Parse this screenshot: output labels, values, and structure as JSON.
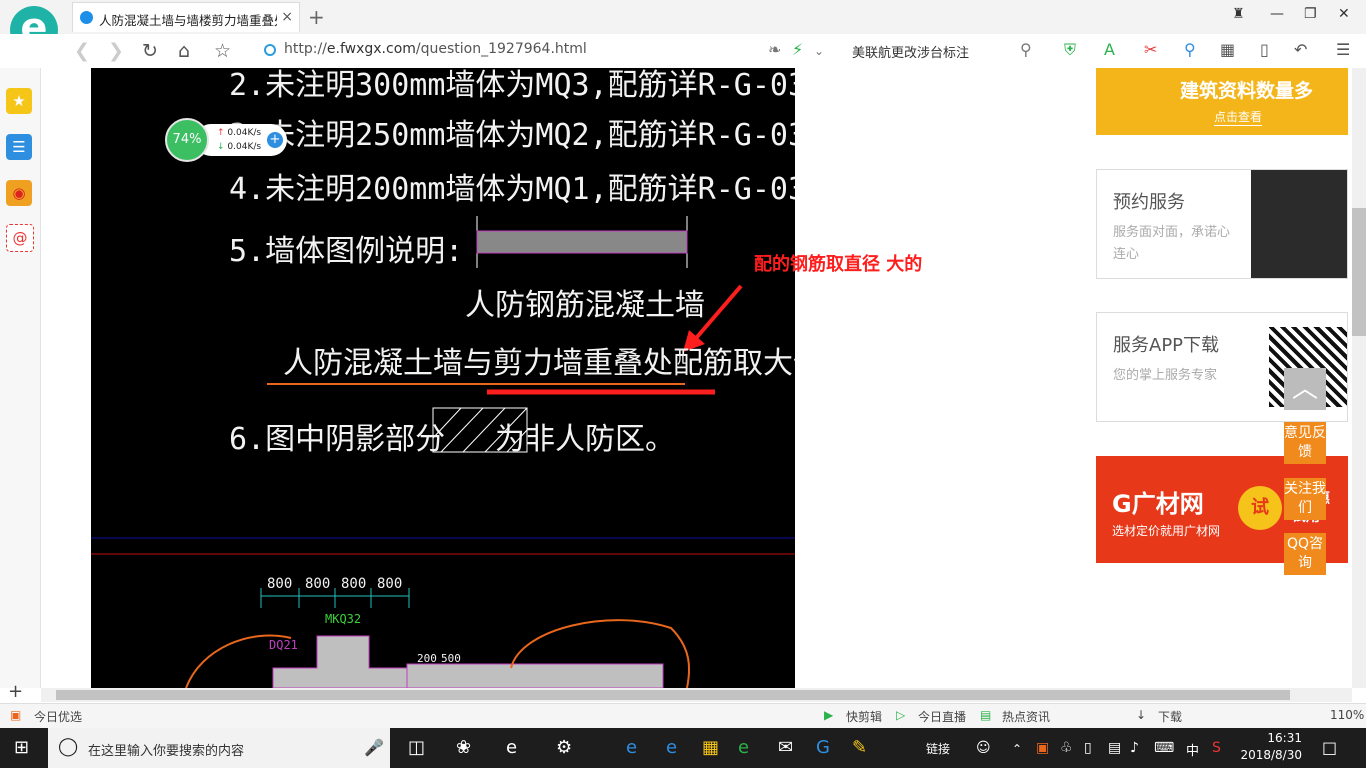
{
  "browser": {
    "tab_title": "人防混凝土墙与墙楼剪力墙重叠处",
    "tab_close": "×",
    "new_tab": "+",
    "url_prefix": "http://",
    "url_domain": "e.fwxgx.com",
    "url_path": "/question_1927964.html",
    "search_hint": "美联航更改涉台标注",
    "logo_letter": "e"
  },
  "speed_widget": {
    "percent": "74%",
    "up": "0.04K/s",
    "down": "0.04K/s"
  },
  "cad": {
    "line2": "2.未注明300mm墙体为MQ3,配筋详R-G-03。",
    "line3": "3.未注明250mm墙体为MQ2,配筋详R-G-03。",
    "line4": "4.未注明200mm墙体为MQ1,配筋详R-G-03。",
    "line5": "5.墙体图例说明:",
    "wall_label": "人防钢筋混凝土墙",
    "overlap_note": "人防混凝土墙与剪力墙重叠处配筋取大值。",
    "line6": "6.图中阴影部分",
    "line6_tail": "为非人防区。",
    "dims": [
      "800",
      "800",
      "800",
      "800"
    ],
    "tag_mkq": "MKQ32",
    "tag_dq": "DQ21",
    "dim_200": "200",
    "dim_500": "500"
  },
  "annotation": {
    "text": "配的钢筋取直径 大的",
    "color": "#ff1e1e"
  },
  "right_column": {
    "banner1_title": "建筑资料数量多",
    "banner1_link": "点击查看",
    "card1_title": "预约服务",
    "card1_desc": "服务面对面，承诺心连心",
    "card2_title": "服务APP下载",
    "card2_desc": "您的掌上服务专家",
    "banner2_logo": "G广材网",
    "banner2_sub": "选材定价就用广材网",
    "banner2_badge": "试",
    "banner2_side": "P优惠试用"
  },
  "float_widget": {
    "to_top": "︿",
    "feedback": "意见反馈",
    "follow": "关注我们",
    "qq": "QQ咨询"
  },
  "status_bar": {
    "left": "今日优选",
    "kuaijianji": "快剪辑",
    "zhibo": "今日直播",
    "news": "热点资讯",
    "download": "下载",
    "zoom": "110%"
  },
  "taskbar": {
    "search_placeholder": "在这里输入你要搜索的内容",
    "link_label": "链接",
    "ime": "中",
    "time": "16:31",
    "date": "2018/8/30"
  },
  "colors": {
    "accent": "#1fb3a7",
    "cad_bg": "#000000",
    "annotation": "#ff1e1e",
    "float_orange": "#f08a1c"
  }
}
